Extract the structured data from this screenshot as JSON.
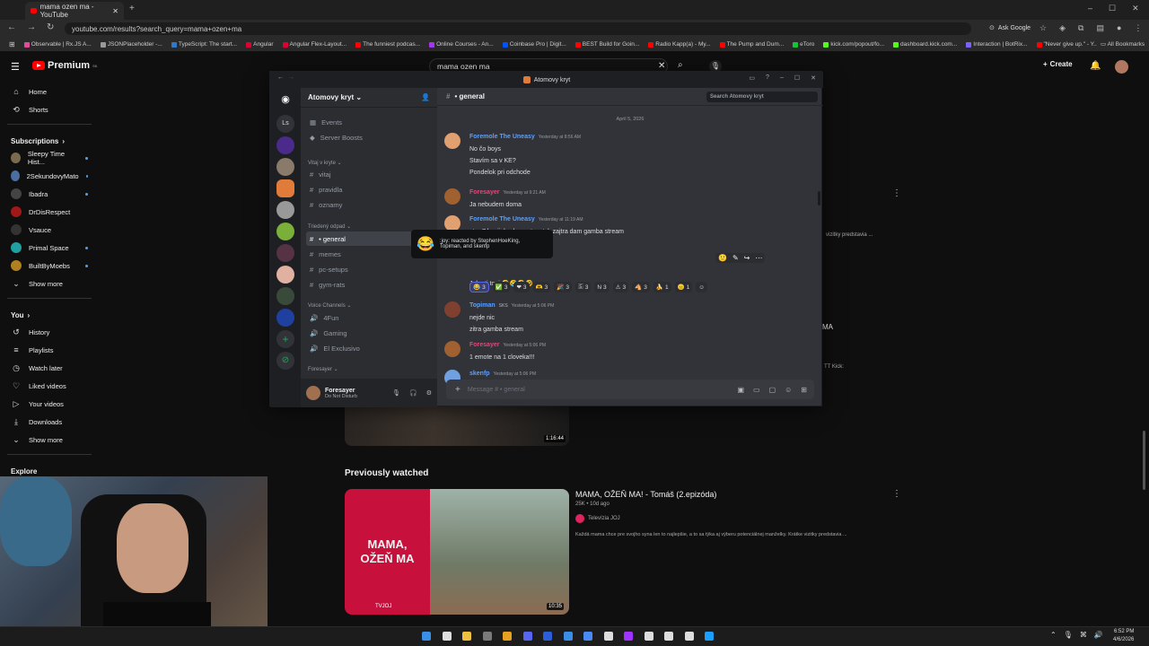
{
  "browser": {
    "tab_title": "mama ozen ma - YouTube",
    "url": "youtube.com/results?search_query=mama+ozen+ma",
    "ask_google": "Ask Google",
    "all_bookmarks": "All Bookmarks",
    "bookmarks": [
      {
        "label": "Observable | Rx.JS A...",
        "color": "#e04c9a"
      },
      {
        "label": "JSONPlaceholder -...",
        "color": "#999"
      },
      {
        "label": "TypeScript: The start...",
        "color": "#3178c6"
      },
      {
        "label": "Angular",
        "color": "#dd0031"
      },
      {
        "label": "Angular Flex-Layout...",
        "color": "#dd0031"
      },
      {
        "label": "The funniest podcas...",
        "color": "#f00"
      },
      {
        "label": "Online Courses - An...",
        "color": "#a435f0"
      },
      {
        "label": "Coinbase Pro | Digit...",
        "color": "#0052ff"
      },
      {
        "label": "BEST Build for Goin...",
        "color": "#f00"
      },
      {
        "label": "Radio Kapp(a) - My...",
        "color": "#f00"
      },
      {
        "label": "The Pump and Dum...",
        "color": "#f00"
      },
      {
        "label": "eToro",
        "color": "#13c636"
      },
      {
        "label": "kick.com/popout/fo...",
        "color": "#53fc18"
      },
      {
        "label": "dashboard.kick.com...",
        "color": "#53fc18"
      },
      {
        "label": "Interaction | BotRix...",
        "color": "#7b61ff"
      },
      {
        "label": "\"Never give up.\" - Y...",
        "color": "#f00"
      }
    ]
  },
  "youtube": {
    "logo": "Premium",
    "logo_sup": "SK",
    "search_value": "mama ozen ma",
    "create_label": "Create",
    "nav": [
      {
        "label": "Home",
        "icon": "⌂"
      },
      {
        "label": "Shorts",
        "icon": "⟲"
      }
    ],
    "subscriptions_label": "Subscriptions",
    "subscriptions": [
      {
        "label": "Sleepy Time Hist...",
        "color": "#7a6a50",
        "dot": true
      },
      {
        "label": "2SekundovyMato",
        "color": "#4a6ea0",
        "dot": true
      },
      {
        "label": "Ibadra",
        "color": "#444",
        "dot": true
      },
      {
        "label": "DrDisRespect",
        "color": "#a01818",
        "dot": false
      },
      {
        "label": "Vsauce",
        "color": "#333",
        "dot": false
      },
      {
        "label": "Primal Space",
        "color": "#20a0a0",
        "dot": true
      },
      {
        "label": "BuiltByMoebs",
        "color": "#b08020",
        "dot": true
      }
    ],
    "show_more": "Show more",
    "you_label": "You",
    "you_items": [
      {
        "label": "History",
        "icon": "↺"
      },
      {
        "label": "Playlists",
        "icon": "≡"
      },
      {
        "label": "Watch later",
        "icon": "◷"
      },
      {
        "label": "Liked videos",
        "icon": "♡"
      },
      {
        "label": "Your videos",
        "icon": "▷"
      },
      {
        "label": "Downloads",
        "icon": "⤓"
      }
    ],
    "show_more_2": "Show more",
    "explore_label": "Explore",
    "section_title": "Previously watched",
    "video": {
      "title": "MAMA, OŽEŇ MA! - Tomáš (2.epizóda)",
      "meta": "25K • 10d ago",
      "channel": "Televízia JOJ",
      "description": "Každá mama chce pre svojho syna len to najlepšie, a to sa týka aj výberu potenciálnej manželky. Krátke vizitky predstavia ...",
      "duration": "10:35",
      "thumb_text": "MAMA,\nOŽEŇ MA",
      "thumb_brand": "TVJOJ"
    },
    "prev_duration": "1:16:44",
    "side_text_1": "vizitky predstavia ...",
    "side_text_2": "MA",
    "side_text_3": "TT Kick:"
  },
  "discord": {
    "window_title": "Atomovy kryt",
    "server_name": "Atomovy kryt",
    "ls": "Ls",
    "events": "Events",
    "server_boosts": "Server Boosts",
    "cat_welcome": "Vitaj v kryte",
    "channels_welcome": [
      "vitaj",
      "pravidla",
      "oznamy"
    ],
    "cat_sorted": "Triedený odpad",
    "channels_sorted": [
      {
        "label": "• general",
        "active": true
      },
      {
        "label": "memes",
        "active": false
      },
      {
        "label": "pc-setups",
        "active": false
      },
      {
        "label": "gym-rats",
        "active": false
      }
    ],
    "cat_voice": "Voice Channels",
    "voice": [
      "4Fun",
      "Gaming",
      "El Exclusivo"
    ],
    "cat_foresayer": "Foresayer",
    "user_name": "Foresayer",
    "user_status": "Do Not Disturb",
    "channel_header": "• general",
    "search_placeholder": "Search Atomovy kryt",
    "date_divider": "April 5, 2026",
    "messages": [
      {
        "author": "Foremole The Uneasy",
        "color": "#5aa0ff",
        "time": "Yesterday at 8:56 AM",
        "lines": [
          "No čo boys",
          "Stavím sa v KE?",
          "Pondelok pri odchode"
        ]
      },
      {
        "author": "Foresayer",
        "color": "#e0487a",
        "time": "Yesterday at 9:21 AM",
        "lines": [
          "Ja nebudem doma"
        ]
      },
      {
        "author": "Foremole The Uneasy",
        "color": "#5aa0ff",
        "time": "Yesterday at 11:19 AM",
        "lines": [
          "ntar 7 hocijakych emotes, tak zajtra dam gamba stream"
        ]
      },
      {
        "author": "",
        "color": "#fff",
        "time": "",
        "lines": [
          "Jebe ti topi 🤣🤣🤣🤣"
        ]
      },
      {
        "author": "Topiman",
        "color": "#5aa0ff",
        "time": "Yesterday at 5:06 PM",
        "tag": "SKS",
        "lines": [
          "nejde nic",
          "zitra gamba stream"
        ]
      },
      {
        "author": "Foresayer",
        "color": "#e0487a",
        "time": "Yesterday at 5:06 PM",
        "lines": [
          "1 emote na 1 cloveka!!!"
        ]
      },
      {
        "author": "skenfp",
        "color": "#5aa0ff",
        "time": "Yesterday at 5:06 PM",
        "lines": []
      }
    ],
    "reactions": [
      {
        "emoji": "😂",
        "count": "3",
        "on": true
      },
      {
        "emoji": "✅",
        "count": "3",
        "on": false
      },
      {
        "emoji": "❤",
        "count": "3",
        "on": false
      },
      {
        "emoji": "🫶",
        "count": "3",
        "on": false
      },
      {
        "emoji": "🎉",
        "count": "3",
        "on": false
      },
      {
        "emoji": "🇸",
        "count": "3",
        "on": false
      },
      {
        "emoji": "N",
        "count": "3",
        "on": false
      },
      {
        "emoji": "⚠",
        "count": "3",
        "on": false
      },
      {
        "emoji": "🐴",
        "count": "3",
        "on": false
      },
      {
        "emoji": "🍌",
        "count": "1",
        "on": false
      },
      {
        "emoji": "😐",
        "count": "1",
        "on": false
      }
    ],
    "tooltip": {
      "emoji": "😂",
      "line1": ":joy: reacted by StephenHoeKing,",
      "line2": "Topiman, and skenfp"
    },
    "composer_placeholder": "Message # • general"
  },
  "taskbar": {
    "time": "6:52 PM",
    "date": "4/6/2026"
  }
}
